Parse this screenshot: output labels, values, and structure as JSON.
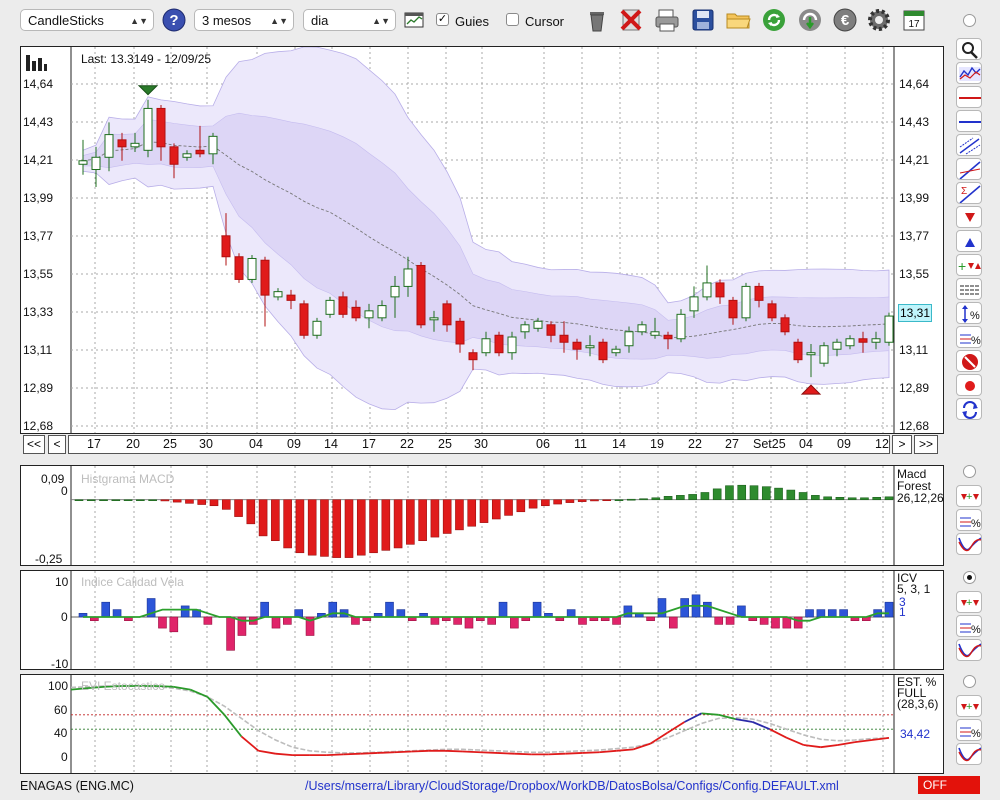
{
  "toolbar": {
    "chart_type": "CandleSticks",
    "period": "3 mesos",
    "interval": "dia",
    "guides_label": "Guies",
    "cursor_label": "Cursor",
    "guides_checked": true,
    "cursor_checked": false,
    "help_glyph": "?",
    "calendar_day": "17"
  },
  "main": {
    "last_label": "Last: 13.3149 - 12/09/25",
    "price_ticks": [
      "14,64",
      "14,43",
      "14,21",
      "13,99",
      "13,77",
      "13,55",
      "13,33",
      "13,11",
      "12,89",
      "12,68"
    ],
    "current_price": "13,31",
    "day_ticks": [
      "17",
      "20",
      "25",
      "30",
      "04",
      "09",
      "14",
      "17",
      "22",
      "25",
      "30",
      "06",
      "11",
      "14",
      "19",
      "22",
      "27",
      "Set25",
      "04",
      "09",
      "12"
    ],
    "nav_first": "<<",
    "nav_prev": "<",
    "nav_next": ">",
    "nav_last": ">>"
  },
  "macd": {
    "title": "Histgrama MACD",
    "legend_line1": "Macd",
    "legend_line2": "Forest",
    "legend_line3": "26,12,26",
    "ticks": [
      "0,09",
      "0",
      "-0,25"
    ]
  },
  "icv": {
    "title": "Indice Calidad Vela",
    "legend_line1": "ICV",
    "legend_line2": "5, 3, 1",
    "value_a": "3",
    "value_b": "1",
    "ticks": [
      "10",
      "0",
      "-10"
    ]
  },
  "stoch": {
    "title": "EVI Estocástico",
    "legend_line1": "EST. %",
    "legend_line2": "FULL",
    "legend_line3": "(28,3,6)",
    "value": "34,42",
    "ticks": [
      "100",
      "60",
      "40",
      "0"
    ]
  },
  "status": {
    "ticker": "ENAGAS (ENG.MC)",
    "path": "/Users/mserra/Library/CloudStorage/Dropbox/WorkDB/DatosBolsa/Configs/Config.DEFAULT.xml",
    "badge": "OFF"
  },
  "colors": {
    "up": "#2e8b2e",
    "down": "#e01b1b",
    "band": "#ddd6f6",
    "accent_blue": "#2233cc"
  },
  "chart_data": [
    {
      "type": "candlestick",
      "x": [
        "17",
        "20",
        "25",
        "30",
        "04",
        "09",
        "14",
        "17",
        "22",
        "25",
        "30",
        "06",
        "11",
        "14",
        "19",
        "22",
        "27",
        "Set25",
        "04",
        "09",
        "12"
      ],
      "ylim": [
        12.68,
        14.64
      ],
      "last": 13.3149,
      "candles": [
        [
          14.18,
          14.2,
          14.32,
          14.12
        ],
        [
          14.15,
          14.22,
          14.28,
          14.05
        ],
        [
          14.22,
          14.35,
          14.42,
          14.14
        ],
        [
          14.32,
          14.28,
          14.36,
          14.2
        ],
        [
          14.28,
          14.3,
          14.36,
          14.25
        ],
        [
          14.26,
          14.5,
          14.55,
          14.22
        ],
        [
          14.5,
          14.28,
          14.52,
          14.2
        ],
        [
          14.28,
          14.18,
          14.3,
          14.1
        ],
        [
          14.22,
          14.24,
          14.26,
          14.2
        ],
        [
          14.26,
          14.24,
          14.4,
          14.22
        ],
        [
          14.24,
          14.34,
          14.36,
          14.18
        ],
        [
          13.77,
          13.65,
          13.9,
          13.6
        ],
        [
          13.65,
          13.52,
          13.67,
          13.5
        ],
        [
          13.52,
          13.64,
          13.66,
          13.5
        ],
        [
          13.63,
          13.43,
          13.65,
          13.25
        ],
        [
          13.42,
          13.45,
          13.47,
          13.4
        ],
        [
          13.43,
          13.4,
          13.46,
          13.35
        ],
        [
          13.38,
          13.2,
          13.4,
          13.18
        ],
        [
          13.2,
          13.28,
          13.3,
          13.18
        ],
        [
          13.32,
          13.4,
          13.42,
          13.3
        ],
        [
          13.42,
          13.32,
          13.45,
          13.3
        ],
        [
          13.36,
          13.3,
          13.4,
          13.28
        ],
        [
          13.3,
          13.34,
          13.38,
          13.24
        ],
        [
          13.3,
          13.37,
          13.4,
          13.28
        ],
        [
          13.42,
          13.48,
          13.54,
          13.3
        ],
        [
          13.48,
          13.58,
          13.65,
          13.42
        ],
        [
          13.6,
          13.26,
          13.62,
          13.24
        ],
        [
          13.3,
          13.3,
          13.34,
          13.22
        ],
        [
          13.38,
          13.26,
          13.4,
          13.22
        ],
        [
          13.28,
          13.15,
          13.3,
          13.1
        ],
        [
          13.1,
          13.06,
          13.12,
          13.0
        ],
        [
          13.1,
          13.18,
          13.22,
          13.08
        ],
        [
          13.2,
          13.1,
          13.22,
          13.08
        ],
        [
          13.1,
          13.19,
          13.22,
          13.06
        ],
        [
          13.22,
          13.26,
          13.28,
          13.18
        ],
        [
          13.24,
          13.28,
          13.3,
          13.22
        ],
        [
          13.26,
          13.2,
          13.28,
          13.16
        ],
        [
          13.2,
          13.16,
          13.28,
          13.1
        ],
        [
          13.16,
          13.12,
          13.18,
          13.06
        ],
        [
          13.13,
          13.14,
          13.2,
          13.08
        ],
        [
          13.16,
          13.06,
          13.18,
          13.04
        ],
        [
          13.1,
          13.12,
          13.14,
          13.08
        ],
        [
          13.14,
          13.22,
          13.25,
          13.1
        ],
        [
          13.22,
          13.26,
          13.28,
          13.2
        ],
        [
          13.2,
          13.22,
          13.3,
          13.18
        ],
        [
          13.2,
          13.18,
          13.22,
          13.12
        ],
        [
          13.18,
          13.32,
          13.35,
          13.16
        ],
        [
          13.34,
          13.42,
          13.48,
          13.3
        ],
        [
          13.42,
          13.5,
          13.6,
          13.4
        ],
        [
          13.5,
          13.42,
          13.52,
          13.38
        ],
        [
          13.4,
          13.3,
          13.42,
          13.26
        ],
        [
          13.3,
          13.48,
          13.5,
          13.28
        ],
        [
          13.48,
          13.4,
          13.5,
          13.36
        ],
        [
          13.38,
          13.3,
          13.4,
          13.28
        ],
        [
          13.3,
          13.22,
          13.32,
          13.2
        ],
        [
          13.16,
          13.06,
          13.18,
          13.04
        ],
        [
          13.1,
          13.1,
          13.15,
          12.96
        ],
        [
          13.04,
          13.14,
          13.16,
          13.02
        ],
        [
          13.12,
          13.16,
          13.18,
          13.08
        ],
        [
          13.14,
          13.18,
          13.2,
          13.12
        ],
        [
          13.18,
          13.16,
          13.22,
          13.1
        ],
        [
          13.16,
          13.18,
          13.22,
          13.12
        ],
        [
          13.16,
          13.31,
          13.33,
          13.14
        ]
      ],
      "markers": [
        {
          "index": 5,
          "kind": "sell"
        },
        {
          "index": 56,
          "kind": "buy"
        }
      ]
    },
    {
      "type": "bar",
      "title": "Histgrama MACD",
      "ylim": [
        -0.25,
        0.09
      ],
      "values": [
        0,
        0,
        0,
        0,
        0,
        0,
        0,
        -0.005,
        -0.01,
        -0.015,
        -0.02,
        -0.025,
        -0.04,
        -0.07,
        -0.1,
        -0.15,
        -0.17,
        -0.2,
        -0.22,
        -0.23,
        -0.235,
        -0.24,
        -0.24,
        -0.23,
        -0.22,
        -0.21,
        -0.2,
        -0.185,
        -0.17,
        -0.155,
        -0.14,
        -0.125,
        -0.11,
        -0.095,
        -0.08,
        -0.065,
        -0.05,
        -0.035,
        -0.025,
        -0.018,
        -0.012,
        -0.008,
        -0.005,
        -0.002,
        0,
        0.002,
        0.004,
        0.008,
        0.014,
        0.018,
        0.022,
        0.03,
        0.045,
        0.058,
        0.06,
        0.058,
        0.054,
        0.048,
        0.04,
        0.03,
        0.018,
        0.012,
        0.01,
        0.008,
        0.008,
        0.01,
        0.012
      ]
    },
    {
      "type": "bar",
      "title": "Indice Calidad Vela",
      "ylim": [
        -10,
        10
      ],
      "values": [
        1,
        -1,
        4,
        2,
        -1,
        0,
        5,
        -3,
        -4,
        3,
        2,
        -2,
        0,
        -9,
        -5,
        -2,
        4,
        -3,
        -2,
        2,
        -5,
        1,
        4,
        2,
        -2,
        -1,
        1,
        4,
        2,
        -1,
        1,
        -2,
        -1,
        -2,
        -3,
        -1,
        -2,
        4,
        -3,
        -1,
        4,
        1,
        -1,
        2,
        -2,
        -1,
        -1,
        -2,
        3,
        1,
        -1,
        5,
        -3,
        5,
        6,
        4,
        -2,
        -2,
        3,
        -1,
        -2,
        -3,
        -3,
        -3,
        2,
        2,
        2,
        2,
        -1,
        -1,
        2,
        4
      ],
      "line": [
        0,
        0,
        0,
        0,
        0,
        0,
        1,
        2,
        2,
        2,
        2,
        1,
        0,
        0,
        -1,
        -1,
        0,
        0,
        0,
        0,
        -1,
        0,
        1,
        1,
        0,
        0,
        0,
        0,
        0,
        0,
        0,
        0,
        0,
        0,
        0,
        0,
        0,
        0,
        0,
        0,
        0,
        0,
        0,
        0,
        0,
        0,
        0,
        0,
        1,
        1,
        1,
        1,
        2,
        3,
        3,
        3,
        2,
        1,
        0,
        0,
        0,
        0,
        0,
        -1,
        -1,
        0,
        0,
        0,
        0,
        0,
        1,
        1
      ]
    },
    {
      "type": "line",
      "title": "EVI Estocástico",
      "ylim": [
        0,
        100
      ],
      "series": [
        {
          "name": "",
          "values": [
            95,
            97,
            99,
            100,
            100,
            100,
            99,
            95,
            85,
            60,
            30,
            10,
            6,
            4,
            4,
            4,
            5,
            6,
            7,
            8,
            9,
            10,
            10,
            9,
            8,
            7,
            6,
            5,
            5,
            6,
            7,
            8,
            10,
            12,
            20,
            35,
            50,
            62,
            60,
            54,
            50,
            40,
            28,
            18,
            15,
            18,
            22,
            25,
            28
          ]
        },
        {
          "name": "",
          "values": [
            98,
            99,
            100,
            100,
            100,
            99,
            97,
            93,
            85,
            72,
            55,
            38,
            25,
            15,
            10,
            8,
            7,
            7,
            8,
            9,
            10,
            11,
            12,
            12,
            11,
            10,
            9,
            8,
            8,
            9,
            10,
            11,
            13,
            15,
            20,
            28,
            38,
            48,
            55,
            56,
            54,
            48,
            40,
            32,
            26,
            24,
            25,
            27,
            28
          ]
        }
      ]
    }
  ]
}
